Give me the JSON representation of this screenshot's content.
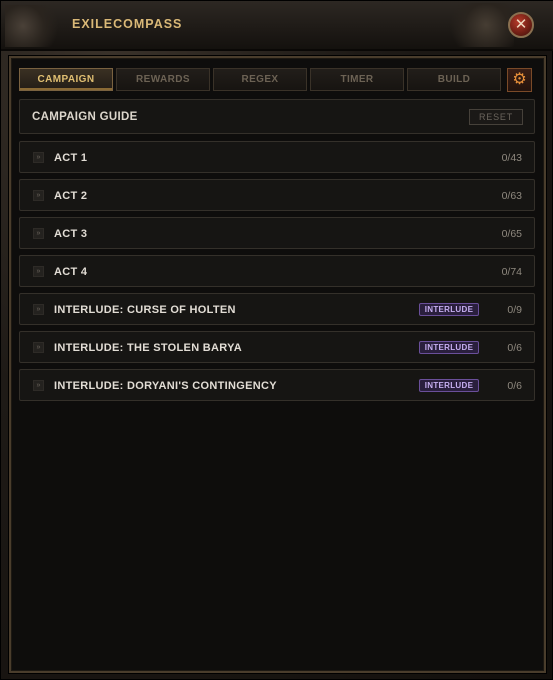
{
  "app": {
    "title": "EXILECOMPASS",
    "close_symbol": "✕"
  },
  "tabs": [
    {
      "label": "CAMPAIGN",
      "active": true
    },
    {
      "label": "REWARDS",
      "active": false
    },
    {
      "label": "REGEX",
      "active": false
    },
    {
      "label": "TIMER",
      "active": false
    },
    {
      "label": "BUILD",
      "active": false
    }
  ],
  "settings": {
    "icon": "gear-icon",
    "glyph": "⚙"
  },
  "guide": {
    "title": "CAMPAIGN GUIDE",
    "reset_label": "RESET"
  },
  "acts": [
    {
      "name": "ACT 1",
      "progress": "0/43",
      "badge": ""
    },
    {
      "name": "ACT 2",
      "progress": "0/63",
      "badge": ""
    },
    {
      "name": "ACT 3",
      "progress": "0/65",
      "badge": ""
    },
    {
      "name": "ACT 4",
      "progress": "0/74",
      "badge": ""
    },
    {
      "name": "INTERLUDE: CURSE OF HOLTEN",
      "progress": "0/9",
      "badge": "INTERLUDE"
    },
    {
      "name": "INTERLUDE: THE STOLEN BARYA",
      "progress": "0/6",
      "badge": "INTERLUDE"
    },
    {
      "name": "INTERLUDE: DORYANI'S CONTINGENCY",
      "progress": "0/6",
      "badge": "INTERLUDE"
    }
  ],
  "expand_glyph": "»",
  "colors": {
    "accent_gold": "#e0bf72",
    "interlude_badge": "#6a4f9a",
    "close_red": "#b83a2a",
    "gear_orange": "#e8903a"
  }
}
